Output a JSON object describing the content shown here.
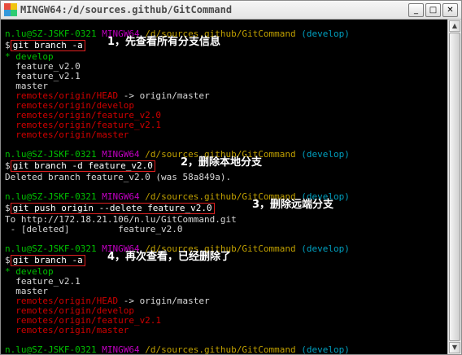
{
  "window": {
    "title": "MINGW64:/d/sources.github/GitCommand",
    "icon": "git-bash-icon",
    "buttons": {
      "minimize": "_",
      "maximize": "□",
      "close": "✕"
    }
  },
  "prompt": {
    "user_host": "n.lu@SZ-JSKF-0321",
    "env": "MINGW64",
    "path": "/d/sources.github/GitCommand",
    "branch": "(develop)",
    "sign": "$"
  },
  "session": {
    "block1": {
      "command": "git branch -a",
      "note": "1，先查看所有分支信息",
      "lines": [
        {
          "text": "* develop",
          "color": "green"
        },
        {
          "text": "  feature_v2.0",
          "color": "white"
        },
        {
          "text": "  feature_v2.1",
          "color": "white"
        },
        {
          "text": "  master",
          "color": "white"
        },
        {
          "text": "  remotes/origin/HEAD",
          "color": "red",
          "suffix": " -> origin/master"
        },
        {
          "text": "  remotes/origin/develop",
          "color": "red"
        },
        {
          "text": "  remotes/origin/feature_v2.0",
          "color": "red"
        },
        {
          "text": "  remotes/origin/feature_v2.1",
          "color": "red"
        },
        {
          "text": "  remotes/origin/master",
          "color": "red"
        }
      ]
    },
    "block2": {
      "command": "git branch -d feature_v2.0",
      "note": "2，删除本地分支",
      "lines": [
        {
          "text": "Deleted branch feature_v2.0 (was 58a849a).",
          "color": "white"
        }
      ]
    },
    "block3": {
      "command": "git push origin --delete feature_v2.0",
      "note": "3，删除远端分支",
      "lines": [
        {
          "text": "To http://172.18.21.106/n.lu/GitCommand.git",
          "color": "white"
        },
        {
          "text": " - [deleted]         feature_v2.0",
          "color": "white"
        }
      ]
    },
    "block4": {
      "command": "git branch -a",
      "note": "4，再次查看，已经删除了",
      "lines": [
        {
          "text": "* develop",
          "color": "green"
        },
        {
          "text": "  feature_v2.1",
          "color": "white"
        },
        {
          "text": "  master",
          "color": "white"
        },
        {
          "text": "  remotes/origin/HEAD",
          "color": "red",
          "suffix": " -> origin/master"
        },
        {
          "text": "  remotes/origin/develop",
          "color": "red"
        },
        {
          "text": "  remotes/origin/feature_v2.1",
          "color": "red"
        },
        {
          "text": "  remotes/origin/master",
          "color": "red"
        }
      ]
    },
    "final_sign": "$"
  },
  "colors": {
    "user_host": "#00c000",
    "env": "#c000c0",
    "path": "#c0a000",
    "branch": "#00a0c0",
    "remote": "#d00000",
    "highlight_box": "#e02020"
  }
}
